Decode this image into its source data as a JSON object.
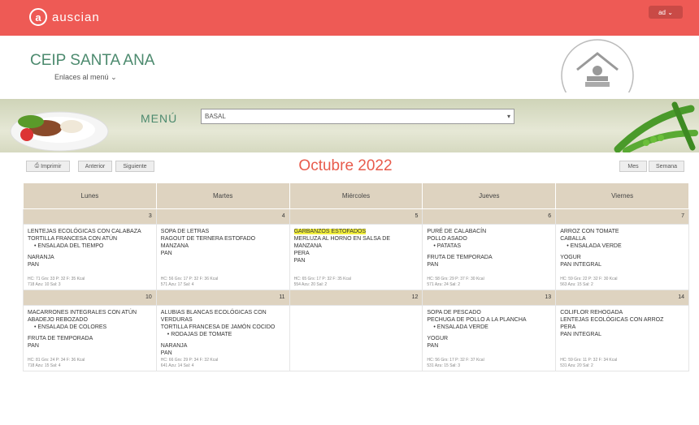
{
  "topbar": {
    "logo": "auscian",
    "logo_letter": "a",
    "user": "ad"
  },
  "school": {
    "name": "CEIP SANTA ANA",
    "links": "Enlaces al menú"
  },
  "menu": {
    "label": "MENÚ",
    "selected": "BASAL"
  },
  "toolbar": {
    "print": "Imprimir",
    "prev": "Anterior",
    "next": "Siguiente",
    "month": "Mes",
    "week": "Semana"
  },
  "calendar": {
    "title": "Octubre 2022",
    "days": [
      "Lunes",
      "Martes",
      "Miércoles",
      "Jueves",
      "Viernes"
    ],
    "weeks": [
      {
        "nums": [
          "3",
          "4",
          "5",
          "6",
          "7"
        ],
        "cells": [
          {
            "lines": [
              {
                "t": "LENTEJAS ECOLÓGICAS CON CALABAZA"
              },
              {
                "t": "TORTILLA FRANCESA CON ATÚN"
              },
              {
                "t": "ENSALADA DEL TIEMPO",
                "b": 1
              },
              {
                "gap": 1
              },
              {
                "t": "NARANJA"
              },
              {
                "t": "PAN"
              }
            ],
            "foot": [
              "HC: 71 Grs: 33 P: 32 F: 35 Kcal",
              "718 Azu: 10 Sal: 3"
            ]
          },
          {
            "lines": [
              {
                "t": "SOPA DE LETRAS"
              },
              {
                "t": "RAGOUT DE TERNERA ESTOFADO"
              },
              {
                "t": "MANZANA"
              },
              {
                "t": "PAN"
              }
            ],
            "foot": [
              "HC: 56 Grs: 17 P: 32 F: 36 Kcal",
              "571 Azu: 17 Sal: 4"
            ]
          },
          {
            "lines": [
              {
                "t": "GARBANZOS ESTOFADOS",
                "hl": 1
              },
              {
                "t": "MERLUZA AL HORNO EN SALSA DE MANZANA"
              },
              {
                "t": "PERA"
              },
              {
                "t": "PAN"
              }
            ],
            "foot": [
              "HC: 65 Grs: 17 P: 32 F: 35 Kcal",
              "554 Azu: 20 Sal: 2"
            ]
          },
          {
            "lines": [
              {
                "t": "PURÉ DE CALABACÍN"
              },
              {
                "t": "POLLO ASADO"
              },
              {
                "t": "PATATAS",
                "b": 1
              },
              {
                "gap": 1
              },
              {
                "t": "FRUTA DE TEMPORADA"
              },
              {
                "t": "PAN"
              }
            ],
            "foot": [
              "HC: 58 Grs: 29 P: 37 F: 30 Kcal",
              "571 Azu: 24 Sal: 2"
            ]
          },
          {
            "lines": [
              {
                "t": "ARROZ CON TOMATE"
              },
              {
                "t": "CABALLA"
              },
              {
                "t": "ENSALADA VERDE",
                "b": 1
              },
              {
                "gap": 1
              },
              {
                "t": "YOGUR"
              },
              {
                "t": "PAN INTEGRAL"
              }
            ],
            "foot": [
              "HC: 59 Grs: 22 P: 32 F: 30 Kcal",
              "563 Azu: 15 Sal: 2"
            ]
          }
        ]
      },
      {
        "nums": [
          "10",
          "11",
          "12",
          "13",
          "14"
        ],
        "cells": [
          {
            "lines": [
              {
                "t": "MACARRONES INTEGRALES CON ATÚN"
              },
              {
                "t": "ABADEJO REBOZADO"
              },
              {
                "t": "ENSALADA DE COLORES",
                "b": 1
              },
              {
                "gap": 1
              },
              {
                "t": "FRUTA DE TEMPORADA"
              },
              {
                "t": "PAN"
              }
            ],
            "foot": [
              "HC: 81 Grs: 24 P: 34 F: 36 Kcal",
              "718 Azu: 15 Sal: 4"
            ]
          },
          {
            "lines": [
              {
                "t": "ALUBIAS BLANCAS ECOLÓGICAS CON VERDURAS"
              },
              {
                "t": "TORTILLA FRANCESA DE JAMÓN COCIDO"
              },
              {
                "t": "RODAJAS DE TOMATE",
                "b": 1
              },
              {
                "gap": 1
              },
              {
                "t": "NARANJA"
              },
              {
                "t": "PAN"
              }
            ],
            "foot": [
              "HC: 66 Grs: 29 P: 34 F: 32 Kcal",
              "641 Azu: 14 Sal: 4"
            ]
          },
          {
            "lines": [],
            "foot": []
          },
          {
            "lines": [
              {
                "t": "SOPA DE PESCADO"
              },
              {
                "t": "PECHUGA DE POLLO A LA PLANCHA"
              },
              {
                "t": "ENSALADA VERDE",
                "b": 1
              },
              {
                "gap": 1
              },
              {
                "t": "YOGUR"
              },
              {
                "t": "PAN"
              }
            ],
            "foot": [
              "HC: 56 Grs: 17 P: 32 F: 37 Kcal",
              "531 Azu: 15 Sal: 3"
            ]
          },
          {
            "lines": [
              {
                "t": "COLIFLOR REHOGADA"
              },
              {
                "t": "LENTEJAS ECOLÓGICAS CON ARROZ"
              },
              {
                "t": "PERA"
              },
              {
                "t": "PAN INTEGRAL"
              }
            ],
            "foot": [
              "HC: 59 Grs: 11 P: 32 F: 34 Kcal",
              "531 Azu: 20 Sal: 2"
            ]
          }
        ]
      }
    ]
  }
}
